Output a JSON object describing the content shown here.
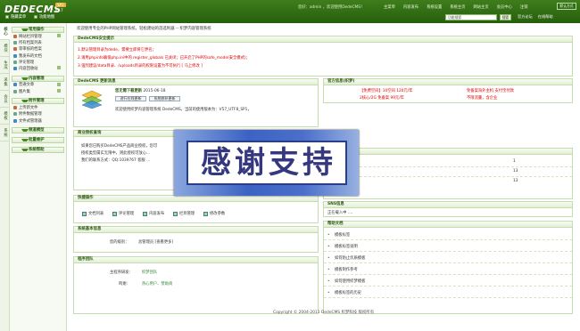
{
  "header": {
    "logo": "DEDECMS",
    "version_badge": "SP1",
    "version": "v5.7",
    "welcome": "您好：admin ，欢迎使用DedeCMS！",
    "nav": [
      "主菜单",
      "内容发布",
      "系统设置",
      "系统主页",
      "网站主页",
      "会员中心",
      "注销"
    ],
    "skin_label": "默认方式",
    "sub_links": [
      "隐藏菜单",
      "功能地图"
    ],
    "search_placeholder": "功能搜索",
    "search_button": "搜索",
    "right_links": [
      "官方论坛",
      "在线帮助"
    ]
  },
  "vtabs": [
    "核心",
    "模块",
    "生成",
    "采集",
    "会员",
    "模板",
    "系统"
  ],
  "sidebar": {
    "sections": [
      {
        "title": "常用操作",
        "items": [
          "网站栏目管理",
          "所有档案列表",
          "等审核的档案",
          "我发布的文档",
          "评论管理",
          "内容回收站"
        ]
      },
      {
        "title": "内容管理",
        "items": [
          "普通文章",
          "图片集"
        ]
      },
      {
        "title": "附件管理",
        "items": [
          "上传新文件",
          "附件数据管理",
          "文件式管理器"
        ]
      },
      {
        "title": "频道模型"
      },
      {
        "title": "批量维护"
      },
      {
        "title": "系统帮助"
      }
    ]
  },
  "main": {
    "breadcrumb": "欢迎使用专业的PHP网站管理系统，轻松建站的首选利器 -- 织梦内容管理系统",
    "security": {
      "title": "DedeCMS安全提示",
      "lines": [
        "1.默认管理目录为dede，需要立即将它更名；",
        "2.请用phpinfo确保php.ini中的 register_globals 已关闭；已开启了PHP的safe_mode(安全模式)；",
        "3.强烈建议/data目录、/uploads目录的权限设置为不可执行 [ 马上修改 ]"
      ],
      "fix_link": "马上修改"
    },
    "update": {
      "title": "DedeCMS 更新消息",
      "msg_prefix": "您无需下载更新",
      "date": "2015-06-18",
      "btn1": "进行在线更新",
      "btn2": "系统修补更新",
      "welcome": "欢迎使用织梦内容管理系统 DedeCMS，当前的使用版本为：V57_UTF8_SP1，"
    },
    "license": {
      "title": "商业授权查询",
      "lines": [
        "如果您已购买DedeCMS产品商业授权，您可",
        "授权类型属实无限中，则此授权可放心...",
        "我们的联系方式：QQ:1039767 客服 ..."
      ]
    },
    "official": {
      "title": "官方信息(织梦)",
      "row1_left": "【免费空间】10空间 120元/年",
      "row1_right": "免备案海外主机 支付宝付款",
      "row2_left": "2核心/2G 免备案 99元/年",
      "row2_right": "不限流量，含企业"
    },
    "stats": {
      "title": "信息统计",
      "values": [
        "1",
        "13",
        "13"
      ]
    },
    "quick": {
      "title": "快捷操作",
      "items": [
        "文档列表",
        "评论管理",
        "内容发布",
        "栏目管理",
        "修改参数"
      ]
    },
    "sysinfo": {
      "title": "系统基本信息",
      "label": "您的级别：",
      "value": "总管理员 [查看更多]"
    },
    "team": {
      "title": "程序团队",
      "row1_label": "主程序研发：",
      "row1_value": "织梦团队",
      "row2_label": "鸣谢：",
      "row2_value": "热心用户、赞助商"
    },
    "news": {
      "title": "SNS信息",
      "line": "正在载入中 ...."
    },
    "docs": {
      "title": "帮助文档",
      "items": [
        "模板标签",
        "模板标签说明",
        "如何防止优质模板",
        "模板制作参考",
        "如何使用织梦模板",
        "模板标签的历史"
      ]
    }
  },
  "footer": "Copyright © 2004-2011 DedeCMS 织梦科技 版权所有",
  "overlay_text": "感谢支持"
}
